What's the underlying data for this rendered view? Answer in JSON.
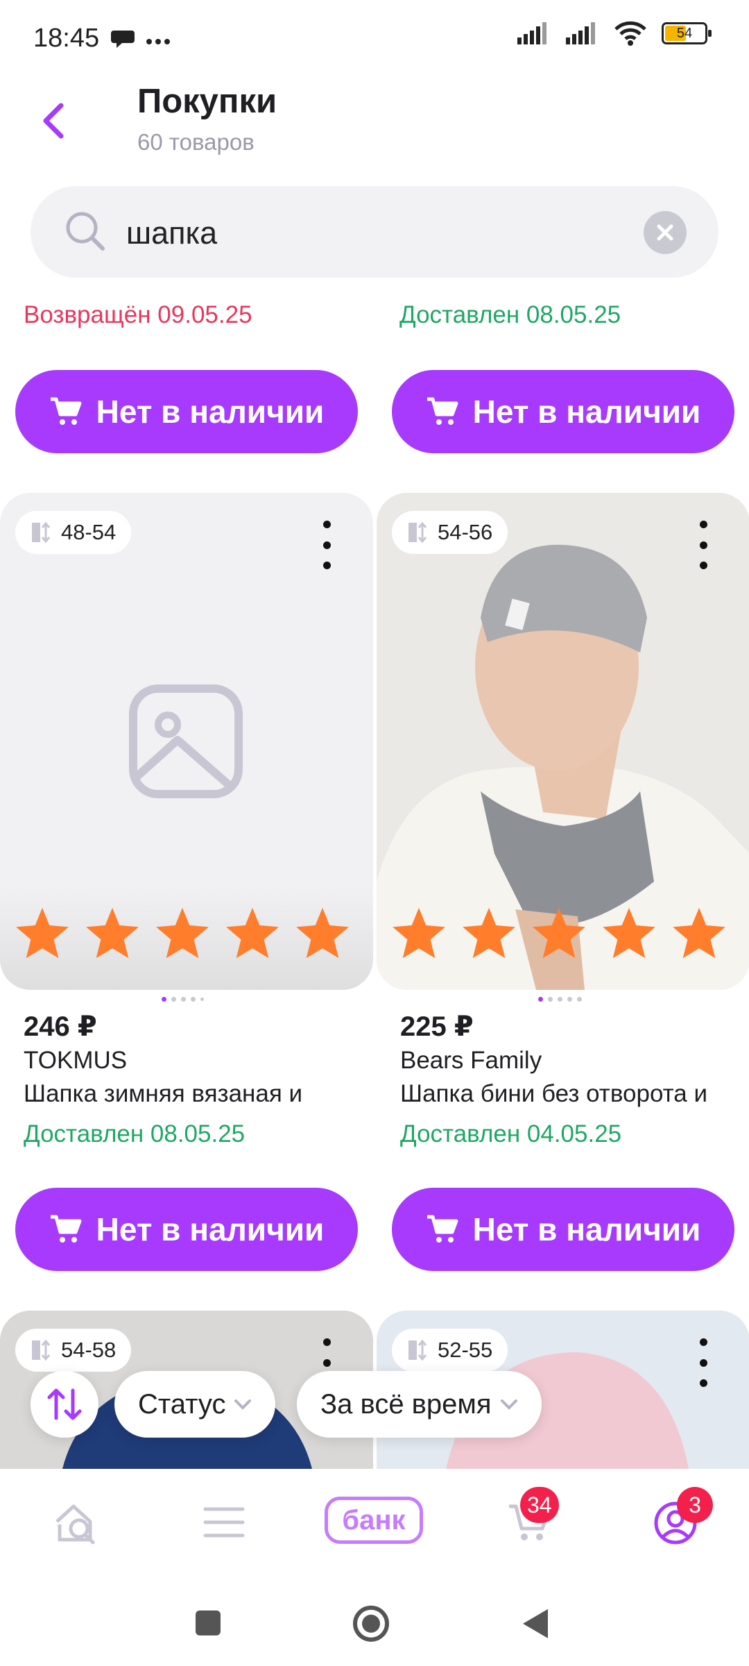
{
  "status_bar": {
    "time": "18:45",
    "battery": "54"
  },
  "header": {
    "title": "Покупки",
    "subtitle": "60 товаров"
  },
  "search": {
    "value": "шапка",
    "placeholder": ""
  },
  "top_row": {
    "left": {
      "status": "Возвращён 09.05.25",
      "button": "Нет в наличии"
    },
    "right": {
      "status": "Доставлен 08.05.25",
      "button": "Нет в наличии"
    }
  },
  "products": [
    {
      "size": "48-54",
      "price": "246 ₽",
      "brand": "TOKMUS",
      "name": "Шапка зимняя вязаная и",
      "status": "Доставлен 08.05.25",
      "button": "Нет в наличии",
      "rating": 5
    },
    {
      "size": "54-56",
      "price": "225 ₽",
      "brand": "Bears Family",
      "name": "Шапка бини без отворота и",
      "status": "Доставлен 04.05.25",
      "button": "Нет в наличии",
      "rating": 5
    }
  ],
  "bottom_cards": [
    {
      "size": "54-58"
    },
    {
      "size": "52-55"
    }
  ],
  "filters": {
    "status_label": "Статус",
    "period_label": "За всё время"
  },
  "bottom_nav": {
    "bank_label": "банк",
    "cart_badge": "34",
    "profile_badge": "3"
  },
  "colors": {
    "accent": "#a73afd",
    "returned": "#e8365c",
    "delivered": "#1fa764",
    "star": "#ff7d2b",
    "badge": "#f2204b"
  }
}
